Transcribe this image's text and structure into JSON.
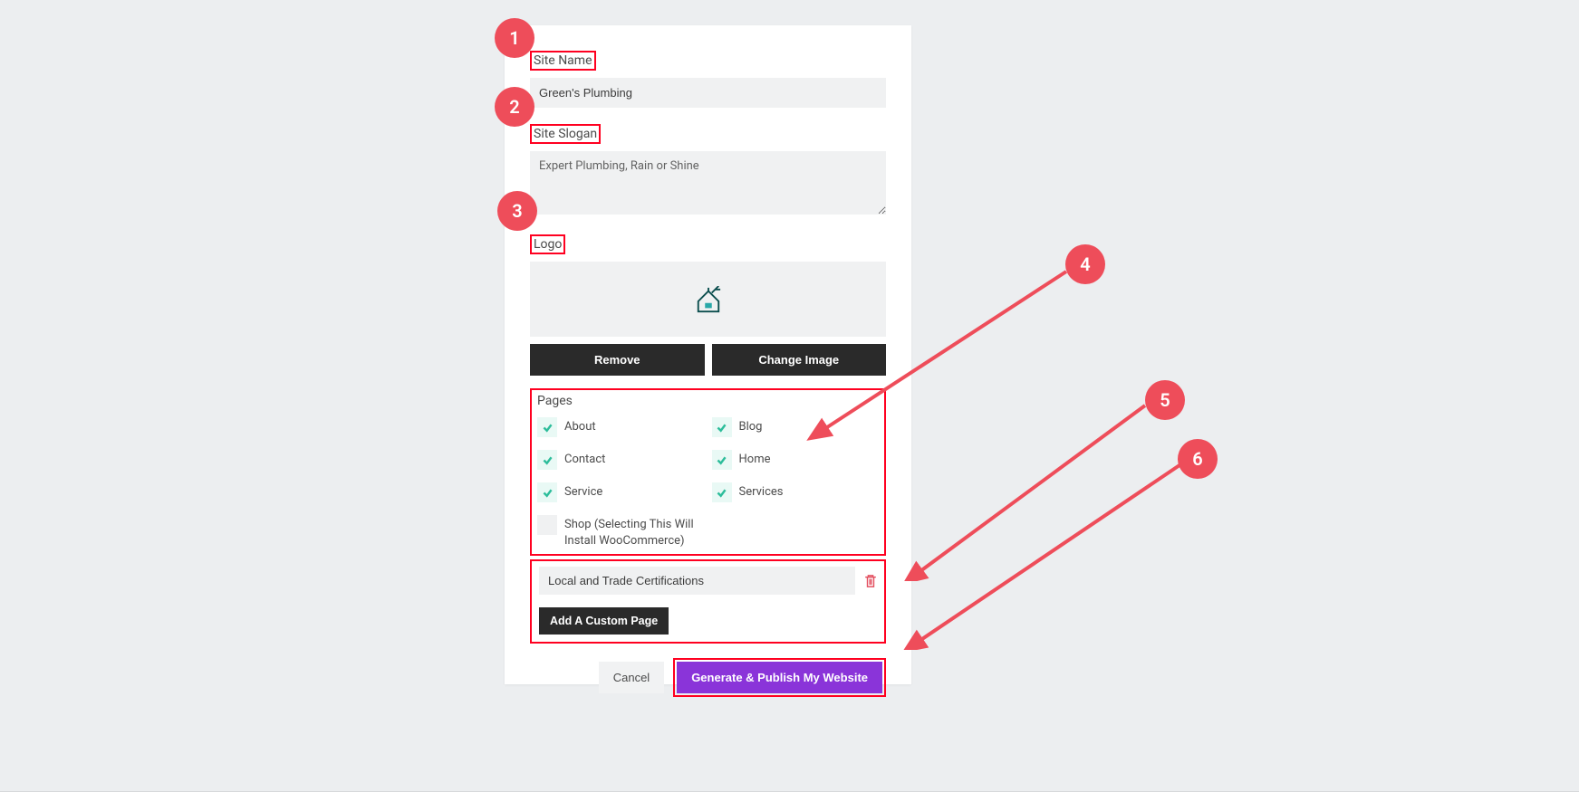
{
  "labels": {
    "site_name": "Site Name",
    "site_slogan": "Site Slogan",
    "logo": "Logo",
    "pages": "Pages"
  },
  "inputs": {
    "site_name_value": "Green's Plumbing",
    "site_slogan_value": "Expert Plumbing, Rain or Shine",
    "custom_page_value": "Local and Trade Certifications"
  },
  "buttons": {
    "remove": "Remove",
    "change_image": "Change Image",
    "add_custom_page": "Add A Custom Page",
    "cancel": "Cancel",
    "generate": "Generate & Publish My Website"
  },
  "pages": {
    "about": "About",
    "blog": "Blog",
    "contact": "Contact",
    "home": "Home",
    "service": "Service",
    "services": "Services",
    "shop": "Shop (Selecting This Will Install WooCommerce)"
  },
  "annotations": {
    "n1": "1",
    "n2": "2",
    "n3": "3",
    "n4": "4",
    "n5": "5",
    "n6": "6"
  },
  "colors": {
    "annotation_red": "#ee4d5a",
    "highlight_border": "#ff0020",
    "primary": "#8a34d9",
    "check_green": "#2dbd9b"
  }
}
